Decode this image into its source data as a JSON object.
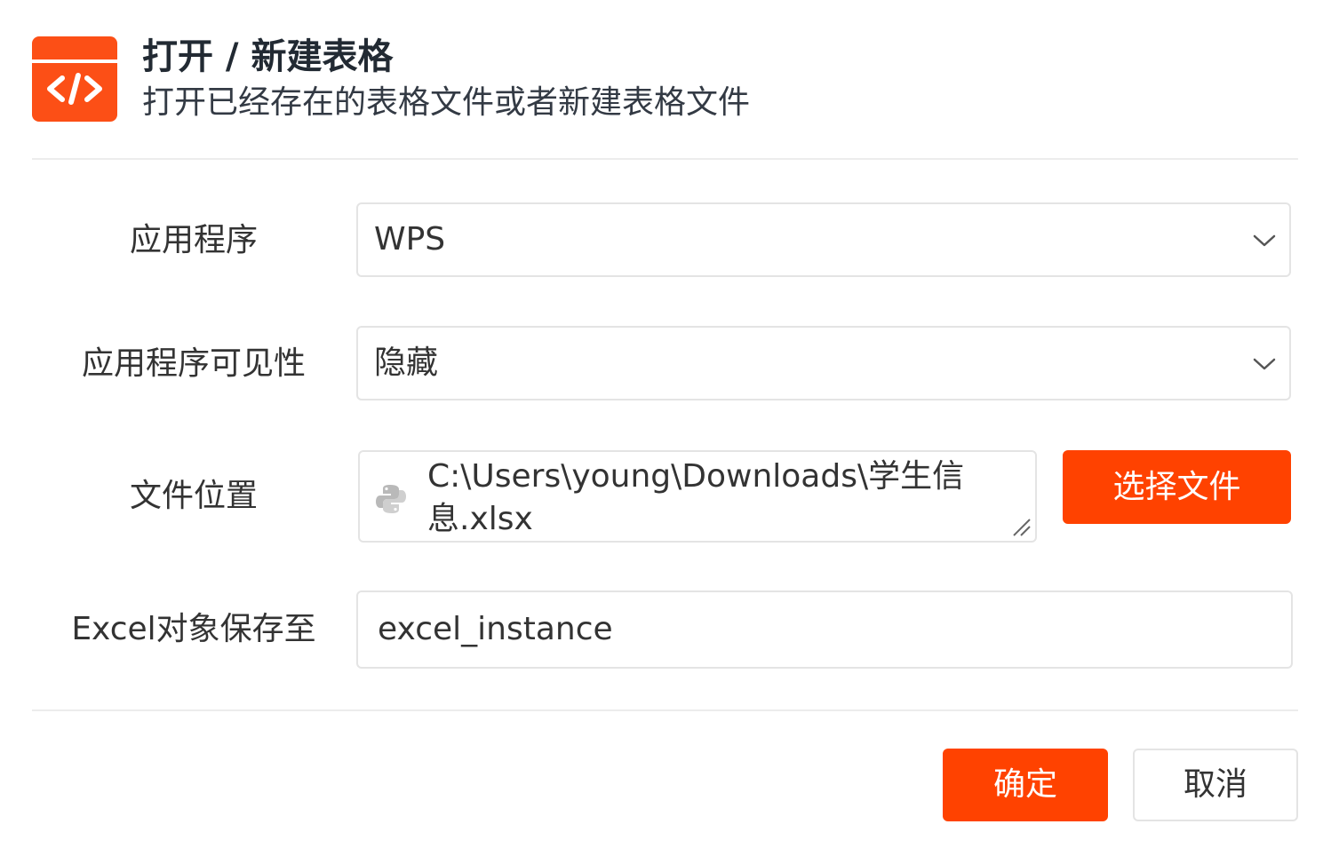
{
  "header": {
    "title": "打开 / 新建表格",
    "subtitle": "打开已经存在的表格文件或者新建表格文件",
    "icon": "code-icon",
    "icon_color": "#fc4f16"
  },
  "form": {
    "application": {
      "label": "应用程序",
      "value": "WPS"
    },
    "visibility": {
      "label": "应用程序可见性",
      "value": "隐藏"
    },
    "file_location": {
      "label": "文件位置",
      "value": "C:\\Users\\young\\Downloads\\学生信息.xlsx",
      "choose_button": "选择文件"
    },
    "save_to": {
      "label": "Excel对象保存至",
      "value": "excel_instance"
    }
  },
  "footer": {
    "confirm": "确定",
    "cancel": "取消"
  },
  "colors": {
    "accent": "#ff4200",
    "border": "#e4e4e4"
  }
}
